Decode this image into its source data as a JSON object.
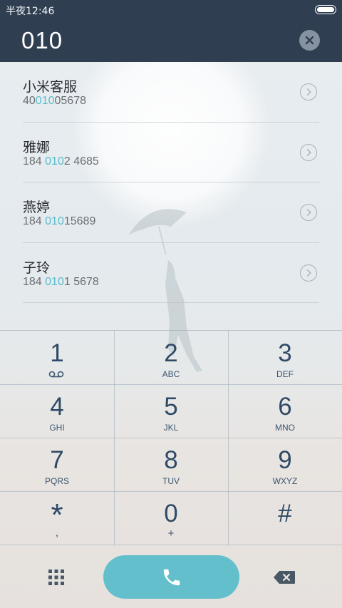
{
  "status_bar": {
    "time": "半夜12:46"
  },
  "input": {
    "number": "010"
  },
  "contacts": [
    {
      "name": "小米客服",
      "number_pre": "40",
      "number_match": "010",
      "number_post": "05678"
    },
    {
      "name": "雅娜",
      "number_pre": "184 ",
      "number_match": "010",
      "number_post": "2 4685"
    },
    {
      "name": "燕婷",
      "number_pre": "184 ",
      "number_match": "010",
      "number_post": "15689"
    },
    {
      "name": "子玲",
      "number_pre": "184 ",
      "number_match": "010",
      "number_post": "1 5678"
    }
  ],
  "dialpad": {
    "keys": [
      {
        "digit": "1",
        "letters": ""
      },
      {
        "digit": "2",
        "letters": "ABC"
      },
      {
        "digit": "3",
        "letters": "DEF"
      },
      {
        "digit": "4",
        "letters": "GHI"
      },
      {
        "digit": "5",
        "letters": "JKL"
      },
      {
        "digit": "6",
        "letters": "MNO"
      },
      {
        "digit": "7",
        "letters": "PQRS"
      },
      {
        "digit": "8",
        "letters": "TUV"
      },
      {
        "digit": "9",
        "letters": "WXYZ"
      },
      {
        "digit": "*",
        "letters": ","
      },
      {
        "digit": "0",
        "letters": "+"
      },
      {
        "digit": "#",
        "letters": ""
      }
    ]
  },
  "colors": {
    "header_bg": "#2f3f51",
    "accent": "#63bfcc",
    "highlight": "#5bbccb",
    "key_text": "#2f4a66"
  },
  "icons": {
    "clear": "clear-circle-icon",
    "voicemail": "voicemail-icon",
    "dialpad_toggle": "dialpad-grid-icon",
    "call": "phone-icon",
    "backspace": "backspace-icon",
    "contact_detail": "chevron-right-icon"
  }
}
